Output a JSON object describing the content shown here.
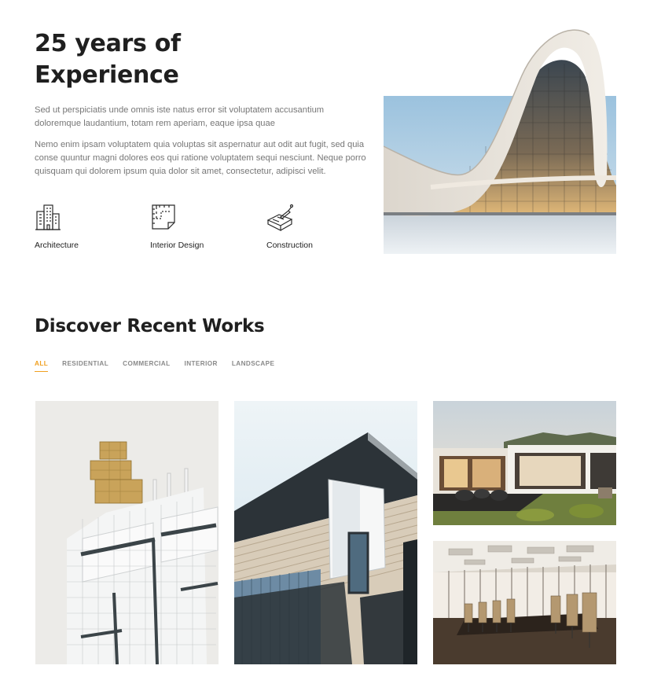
{
  "about": {
    "title_line1": "25 years of",
    "title_line2": "Experience",
    "paragraph1": "Sed ut perspiciatis unde omnis iste natus error sit voluptatem accusantium doloremque laudantium, totam rem aperiam, eaque ipsa quae",
    "paragraph2": "Nemo enim ipsam voluptatem quia voluptas sit aspernatur aut odit aut fugit, sed quia conse quuntur magni dolores eos qui ratione voluptatem sequi nesciunt. Neque porro quisquam qui dolorem ipsum quia dolor sit amet, consectetur, adipisci velit.",
    "features": [
      {
        "label": "Architecture",
        "icon": "buildings-icon"
      },
      {
        "label": "Interior Design",
        "icon": "blueprint-icon"
      },
      {
        "label": "Construction",
        "icon": "trowel-brick-icon"
      }
    ]
  },
  "works": {
    "title": "Discover Recent Works",
    "filters": [
      "ALL",
      "RESIDENTIAL",
      "COMMERCIAL",
      "INTERIOR",
      "LANDSCAPE"
    ],
    "active_filter": "ALL"
  },
  "colors": {
    "accent": "#f0a020",
    "heading": "#1f1f1f",
    "body_text": "#777777"
  }
}
